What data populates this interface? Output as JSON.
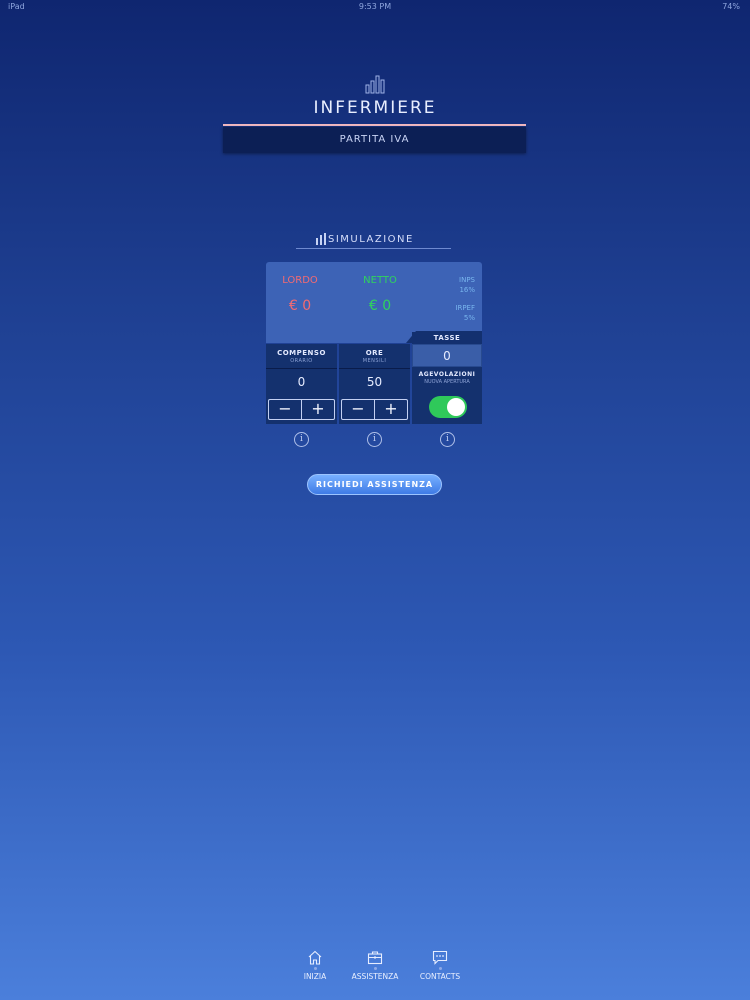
{
  "status_bar": {
    "left": "iPad",
    "time": "9:53 PM",
    "battery": "74%"
  },
  "header": {
    "icon": "bar-chart-icon",
    "title": "INFERMIERE",
    "subtitle": "PARTITA IVA"
  },
  "simulation": {
    "section_label": "SIMULAZIONE",
    "lordo": {
      "label": "LORDO",
      "value": "€ 0",
      "color": "#f26a72"
    },
    "netto": {
      "label": "NETTO",
      "value": "€ 0",
      "color": "#2fd35e"
    },
    "taxes": {
      "inps_label": "INPS",
      "inps_value": "16%",
      "irpef_label": "IRPEF",
      "irpef_value": "5%"
    },
    "compenso": {
      "label": "COMPENSO",
      "sublabel": "ORARIO",
      "value": "0",
      "minus": "−",
      "plus": "+"
    },
    "ore": {
      "label": "ORE",
      "sublabel": "MENSILI",
      "value": "50",
      "minus": "−",
      "plus": "+"
    },
    "tasse": {
      "label": "TASSE",
      "value": "0"
    },
    "agevolazioni": {
      "label": "AGEVOLAZIONI",
      "sublabel": "NUOVA APERTURA",
      "toggle_on": true
    },
    "info_glyph": "i"
  },
  "assist_button": "RICHIEDI ASSISTENZA",
  "tabbar": [
    {
      "label": "INIZIA",
      "icon": "home-icon"
    },
    {
      "label": "ASSISTENZA",
      "icon": "briefcase-icon"
    },
    {
      "label": "CONTACTS",
      "icon": "chat-icon"
    }
  ]
}
